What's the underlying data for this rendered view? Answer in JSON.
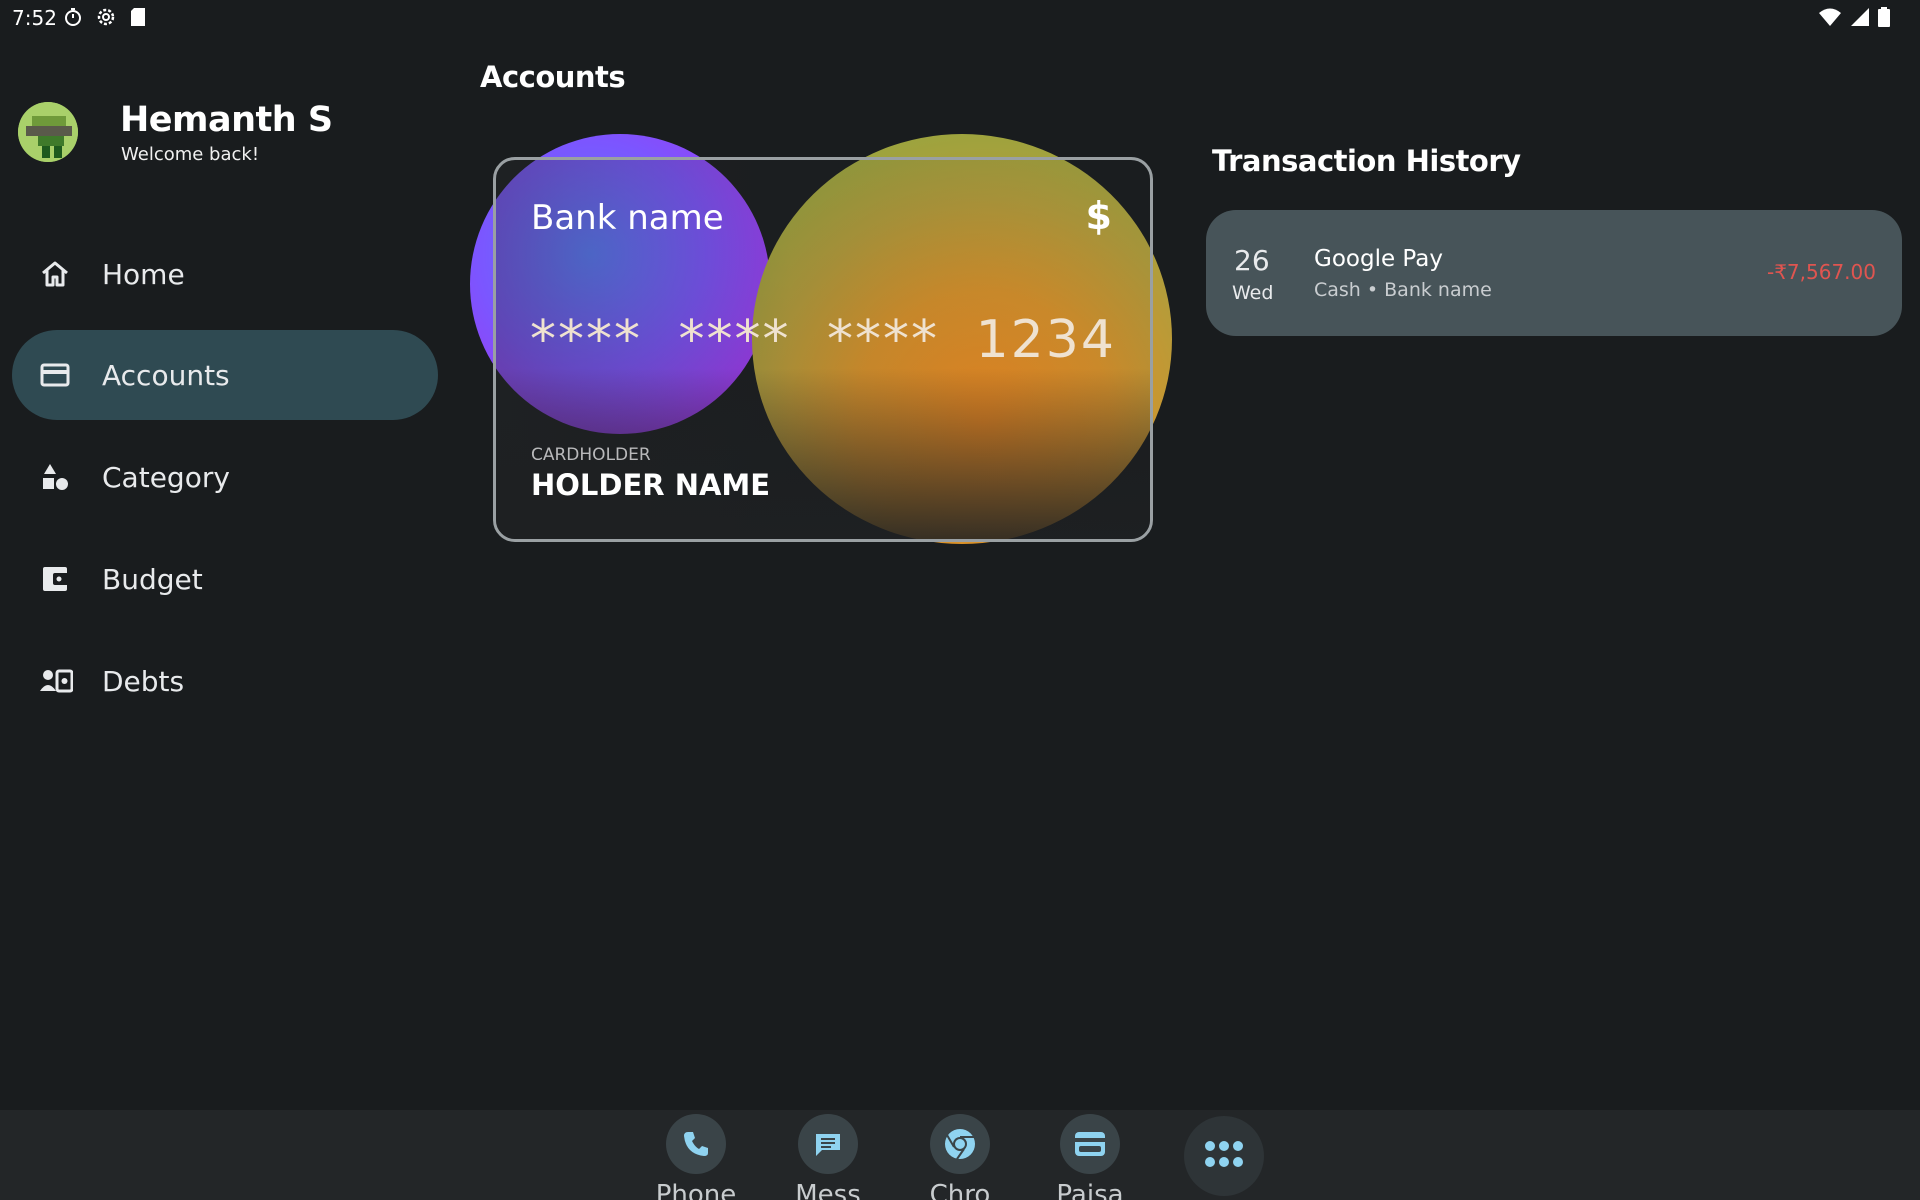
{
  "status_bar": {
    "time": "7:52"
  },
  "sidebar": {
    "user_name": "Hemanth S",
    "welcome": "Welcome back!",
    "items": [
      {
        "label": "Home",
        "icon": "home-icon",
        "active": false
      },
      {
        "label": "Accounts",
        "icon": "credit-card-icon",
        "active": true
      },
      {
        "label": "Category",
        "icon": "category-icon",
        "active": false
      },
      {
        "label": "Budget",
        "icon": "wallet-icon",
        "active": false
      },
      {
        "label": "Debts",
        "icon": "debts-icon",
        "active": false
      }
    ]
  },
  "main": {
    "title": "Accounts",
    "card": {
      "bank_name": "Bank name",
      "currency": "$",
      "number": "**** **** **** 1234",
      "holder_label": "CARDHOLDER",
      "holder_name": "HOLDER NAME"
    },
    "transactions": {
      "title": "Transaction History",
      "items": [
        {
          "day": "26",
          "weekday": "Wed",
          "name": "Google Pay",
          "meta": "Cash • Bank name",
          "amount": "-₹7,567.00"
        }
      ]
    }
  },
  "dock": {
    "apps": [
      {
        "label": "Phone",
        "icon": "phone-icon"
      },
      {
        "label": "Mess",
        "icon": "messages-icon"
      },
      {
        "label": "Chro",
        "icon": "chrome-icon"
      },
      {
        "label": "Paisa",
        "icon": "paisa-icon"
      }
    ],
    "all_apps_icon": "app-drawer-icon"
  },
  "colors": {
    "background": "#191c1e",
    "nav_active": "#2f4a52",
    "transaction_item": "#475459",
    "negative_amount": "#e05550",
    "dock_icon": "#8fd3f0"
  }
}
